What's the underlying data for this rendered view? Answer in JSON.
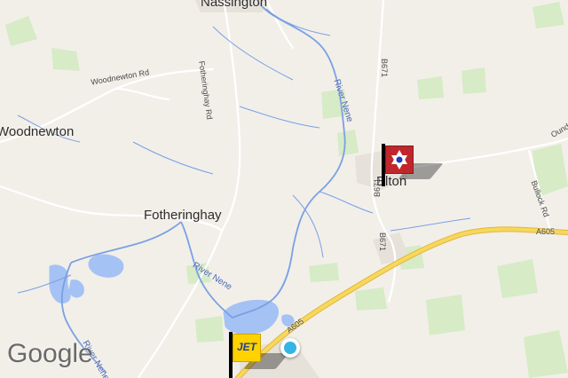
{
  "places": {
    "nassington": "Nassington",
    "woodnewton": "Woodnewton",
    "fotheringhay": "Fotheringhay",
    "elton": "Elton"
  },
  "roads": {
    "fotheringhay_rd": "Fotheringhay Rd",
    "woodnewton_rd": "Woodnewton Rd",
    "b671_north": "B671",
    "b671_mid": "B671",
    "b671_south": "B671",
    "a605_east": "A605",
    "a605_west": "A605",
    "bullock_rd": "Bullock Rd",
    "oundle_rd": "Ound"
  },
  "rivers": {
    "nene_north": "River Nene",
    "nene_mid": "River Nene",
    "nene_south": "River Nene"
  },
  "branding": {
    "logo": "Google"
  },
  "markers": {
    "poi_marker": {
      "icon": "star-of-david-icon",
      "color": "#c0272d"
    },
    "fuel_marker": {
      "text": "JET",
      "color": "#ffd200"
    }
  },
  "colors": {
    "land": "#f2efe9",
    "water": "#a5c2f4",
    "river_line": "#7aa0e4",
    "park": "#cde8c1",
    "major_road": "#f6d85b",
    "minor_road": "#ffffff"
  }
}
